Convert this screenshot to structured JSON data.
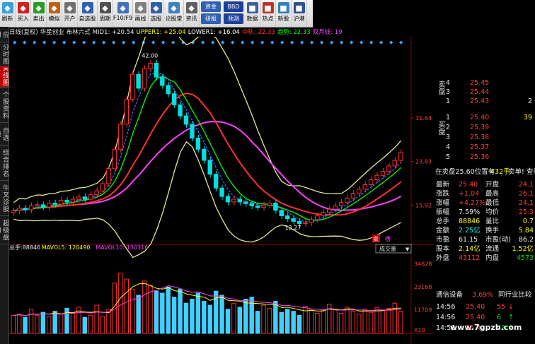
{
  "toolbar": {
    "buttons": [
      {
        "label": "刷新",
        "icon": "refresh-icon",
        "color": "#3aa0d8"
      },
      {
        "label": "买入",
        "icon": "buy-icon",
        "color": "#d02020"
      },
      {
        "label": "卖出",
        "icon": "sell-icon",
        "color": "#20a020"
      },
      {
        "label": "模拟",
        "icon": "gavel-icon",
        "color": "#c06010"
      },
      {
        "label": "开户",
        "icon": "lock-icon",
        "color": "#707070"
      },
      {
        "label": "自选股",
        "icon": "watchlist-icon",
        "color": "#3060b0"
      },
      {
        "label": "周期",
        "icon": "clock-icon",
        "color": "#505050"
      },
      {
        "label": "F10/F9",
        "icon": "f10-icon",
        "color": "#4070c0"
      },
      {
        "label": "画线",
        "icon": "draw-line-icon",
        "color": "#808080"
      },
      {
        "label": "选股",
        "icon": "stock-picker-icon",
        "color": "#3060b0"
      },
      {
        "label": "论股堂",
        "icon": "forum-icon",
        "color": "#4080c0"
      },
      {
        "label": "资讯",
        "icon": "news-icon",
        "color": "#606060"
      }
    ],
    "chips_top": [
      "资金",
      "研报"
    ],
    "chips_bottom": [
      "BBD",
      "预测"
    ],
    "extra": [
      {
        "label": "数据",
        "icon": "data-icon",
        "color": "#4060a0"
      },
      {
        "label": "热点",
        "icon": "hotspot-icon",
        "color": "#c03030"
      },
      {
        "label": "新股",
        "icon": "new-stock-icon",
        "color": "#3080c0"
      },
      {
        "label": "沪港",
        "icon": "hk-icon",
        "color": "#305090"
      }
    ]
  },
  "left_tabs": [
    {
      "label": "应用",
      "active": false
    },
    {
      "label": "分时图",
      "active": false
    },
    {
      "label": "K线图",
      "active": true
    },
    {
      "label": "个股资料",
      "active": false
    },
    {
      "label": "自选股",
      "active": false
    },
    {
      "label": "综合排名",
      "active": false
    },
    {
      "label": "牛叉诊股",
      "active": false
    },
    {
      "label": "超级盘口",
      "active": false
    }
  ],
  "infoline": [
    {
      "text": "日线(复权)",
      "color": "#e8e8e8"
    },
    {
      "text": "华星创业",
      "color": "#e8e8e8"
    },
    {
      "text": "布林六式",
      "color": "#e8e8e8"
    },
    {
      "text": "MID1: +20.54",
      "color": "#e8e8e8"
    },
    {
      "text": "UPPER1: +25.04",
      "color": "#ffff00"
    },
    {
      "text": "LOWER1: +16.04",
      "color": "#ffffff"
    },
    {
      "text": "中轨: 22.33",
      "color": "#ff3030"
    },
    {
      "text": "趋势: 22.33",
      "color": "#00ff00"
    },
    {
      "text": "双月线: 19",
      "color": "#ff40ff"
    }
  ],
  "chart_data": [
    {
      "type": "candlestick",
      "title": "",
      "y_ticks": [
        31.64,
        23.83,
        15.92
      ],
      "annotations": [
        "42.00",
        "12.27"
      ],
      "series": [
        {
          "name": "中轨",
          "color": "#ff3030"
        },
        {
          "name": "趋势",
          "color": "#00ff00"
        },
        {
          "name": "双月线",
          "color": "#ff40ff"
        },
        {
          "name": "UPPER1",
          "color": "#ffff00"
        },
        {
          "name": "LOWER1",
          "color": "#ffffff"
        }
      ],
      "close": [
        14.9,
        15.4,
        15.1,
        15.8,
        16.0,
        15.6,
        16.3,
        16.1,
        16.8,
        16.5,
        17.0,
        17.4,
        17.0,
        17.8,
        18.5,
        19.8,
        22.5,
        26.0,
        30.5,
        35.0,
        39.5,
        37.0,
        40.5,
        41.5,
        39.0,
        37.5,
        36.0,
        34.0,
        32.0,
        30.5,
        28.0,
        26.0,
        24.0,
        21.5,
        19.0,
        17.5,
        16.5,
        17.0,
        16.5,
        16.2,
        15.8,
        15.5,
        15.9,
        16.3,
        15.0,
        14.0,
        13.5,
        13.0,
        12.6,
        12.8,
        13.3,
        14.0,
        14.6,
        15.2,
        15.8,
        16.4,
        17.2,
        18.0,
        18.8,
        19.6,
        20.5,
        21.3,
        22.0,
        23.0,
        24.0,
        25.4
      ]
    },
    {
      "type": "bar",
      "title": "",
      "labels": [
        "总手:88846",
        "MAVOL5: 120490",
        "MAVOL10: 130316"
      ],
      "y_ticks": [
        34628,
        23168,
        11709
      ],
      "unit": "X10",
      "values": [
        9000,
        9500,
        8000,
        12000,
        9000,
        10500,
        8500,
        11000,
        9500,
        12500,
        10000,
        13000,
        8000,
        9000,
        14000,
        8500,
        12000,
        25000,
        30000,
        27000,
        22000,
        19000,
        26000,
        24000,
        21000,
        20000,
        23000,
        18000,
        22000,
        15000,
        17000,
        20000,
        16000,
        14000,
        21000,
        19000,
        12000,
        15000,
        13000,
        17000,
        18000,
        11000,
        14000,
        12500,
        16000,
        10500,
        12000,
        11000,
        9000,
        13500,
        12000,
        10000,
        11500,
        14500,
        12000,
        10000,
        13000,
        11000,
        9500,
        12000,
        10500,
        13000,
        11500,
        12500,
        15000,
        11000
      ]
    }
  ],
  "right_panel": {
    "ask_label": "卖盘",
    "asks": [
      {
        "idx": "4",
        "price": "25.45",
        "vol": ""
      },
      {
        "idx": "3",
        "price": "25.44",
        "vol": ""
      },
      {
        "idx": "1",
        "price": "25.43",
        "vol": "2"
      }
    ],
    "bid_label": "买盘",
    "bids": [
      {
        "idx": "1",
        "price": "25.40",
        "vol": "39"
      },
      {
        "idx": "2",
        "price": "25.39",
        "vol": ""
      },
      {
        "idx": "3",
        "price": "25.38",
        "vol": ""
      },
      {
        "idx": "4",
        "price": "25.37",
        "vol": ""
      },
      {
        "idx": "5",
        "price": "25.36",
        "vol": ""
      }
    ],
    "weibi_line": {
      "a": "在卖盘25.60位置有",
      "b": "432手",
      "c": "卖单! 查看详情"
    },
    "stats": [
      {
        "k1": "最新",
        "v1": "25.40",
        "k2": "开盘",
        "v2": "24.1",
        "c1": "red",
        "c2": "red"
      },
      {
        "k1": "涨跌",
        "v1": "+1.04",
        "k2": "最高",
        "v2": "26.1",
        "c1": "red",
        "c2": "red"
      },
      {
        "k1": "涨幅",
        "v1": "+4.27%",
        "k2": "最低",
        "v2": "24.1",
        "c1": "red",
        "c2": "red"
      },
      {
        "k1": "振幅",
        "v1": "7.59%",
        "k2": "均价",
        "v2": "25.3",
        "c1": "white",
        "c2": "red"
      },
      {
        "k1": "总手",
        "v1": "88846",
        "k2": "量比",
        "v2": "0.7",
        "c1": "yellow",
        "c2": "yellow"
      },
      {
        "k1": "金额",
        "v1": "2.25亿",
        "k2": "换手",
        "v2": "5.84",
        "c1": "cyan",
        "c2": "yellow"
      },
      {
        "k1": "市盈",
        "v1": "61.15",
        "k2": "市盈(动)",
        "v2": "86.2",
        "c1": "white",
        "c2": "white"
      },
      {
        "k1": "股本",
        "v1": "2.14亿",
        "k2": "流通",
        "v2": "1.52亿",
        "c1": "yellow",
        "c2": "yellow"
      },
      {
        "k1": "外盘",
        "v1": "43112",
        "k2": "内盘",
        "v2": "4573",
        "c1": "red",
        "c2": "green"
      }
    ],
    "industry": {
      "name": "通信设备",
      "pct": "3.69%",
      "link": "同行业比较"
    },
    "ticks": [
      {
        "time": "14:56",
        "price": "25.40",
        "vol": "55",
        "dir": "down"
      },
      {
        "time": "14:56",
        "price": "25.40",
        "vol": "6",
        "dir": "up"
      },
      {
        "time": "14:56",
        "price": "25.40",
        "vol": "43",
        "dir": "up"
      }
    ]
  },
  "panel_labels": {
    "sell": "卖",
    "buy": "楞",
    "vol_type": "成交量"
  },
  "watermark": "www.7gpzb.com"
}
